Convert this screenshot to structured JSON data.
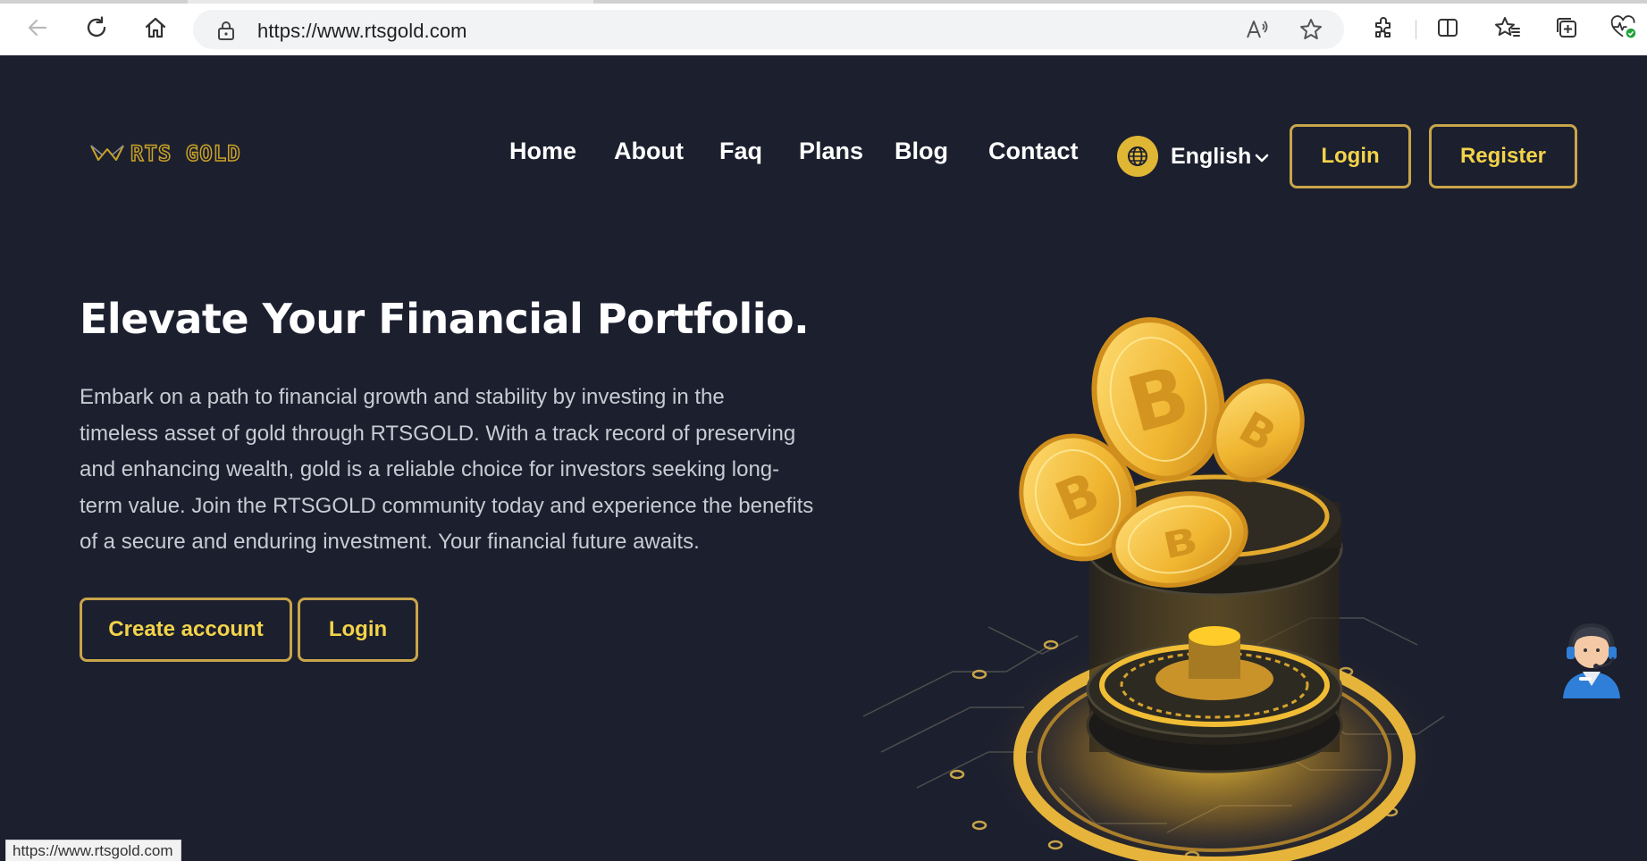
{
  "browser": {
    "url": "https://www.rtsgold.com",
    "status_url": "https://www.rtsgold.com"
  },
  "site": {
    "logo_text": "RTS GOLD",
    "nav": [
      "Home",
      "About",
      "Faq",
      "Plans",
      "Blog",
      "Contact"
    ],
    "language": "English",
    "login_label": "Login",
    "register_label": "Register"
  },
  "hero": {
    "title": "Elevate Your Financial Portfolio.",
    "lines": [
      "Embark on a path to financial growth and stability by investing in the",
      "timeless asset of gold through RTSGOLD. With a track record of preserving",
      "and enhancing wealth, gold is a reliable choice for investors seeking long-",
      "term value. Join the RTSGOLD community today and experience the benefits",
      "of a secure and enduring investment. Your financial future awaits."
    ],
    "create_account_label": "Create account",
    "login_label": "Login"
  },
  "colors": {
    "page_bg": "#1c1f2e",
    "accent_gold": "#c9a54a",
    "button_text": "#f3d34a"
  },
  "icons": [
    "back-arrow-icon",
    "refresh-icon",
    "home-icon",
    "lock-icon",
    "read-aloud-icon",
    "favorite-star-icon",
    "extensions-icon",
    "split-screen-icon",
    "favorites-icon",
    "collections-icon",
    "health-icon",
    "globe-icon",
    "chevron-down-icon",
    "support-agent-icon"
  ]
}
